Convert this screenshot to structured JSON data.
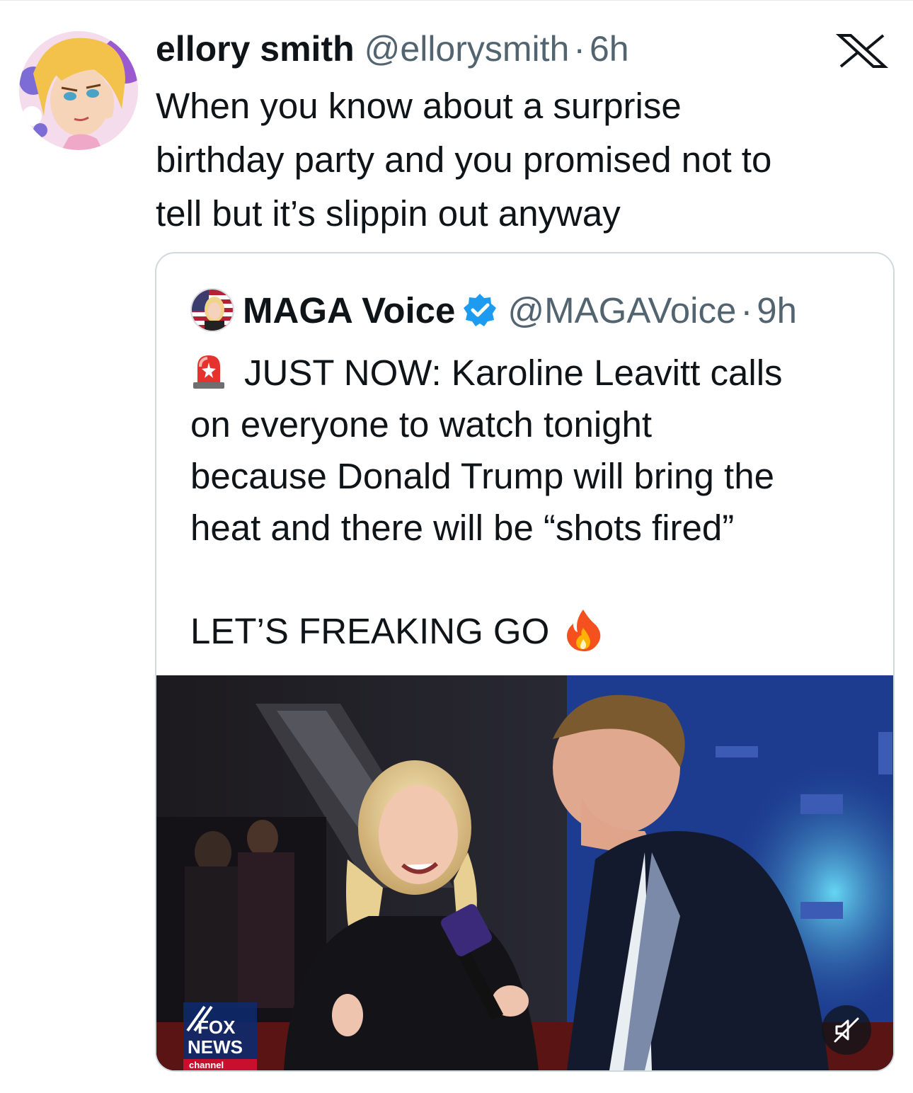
{
  "tweet": {
    "author_name": "ellory smith",
    "author_handle": "@ellorysmith",
    "separator": "·",
    "time": "6h",
    "text_lines": [
      "When you know about a surprise",
      "birthday party and you promised not to",
      "tell but it’s slippin out anyway"
    ],
    "icons": {
      "avatar": "cartoon-avatar",
      "platform": "x-logo-icon"
    }
  },
  "quote": {
    "author_name": "MAGA Voice",
    "author_handle": "@MAGAVoice",
    "separator": "·",
    "time": "9h",
    "verified": true,
    "text_lines": [
      "JUST NOW: Karoline Leavitt calls",
      "on everyone to watch tonight",
      "because Donald Trump will bring the",
      "heat and there will be “shots fired”"
    ],
    "closing_line": "LET’S FREAKING GO",
    "icons": {
      "lead": "police-light-emoji",
      "trail": "fire-emoji",
      "verified": "verified-badge-icon"
    }
  },
  "media": {
    "type": "video",
    "watermark": "FOX NEWS",
    "watermark_sub": "channel",
    "muted": true,
    "icons": {
      "mute": "speaker-muted-icon"
    }
  },
  "colors": {
    "text": "#0f1419",
    "secondary": "#536471",
    "border": "#cfd9de",
    "verified": "#1d9bf0"
  }
}
